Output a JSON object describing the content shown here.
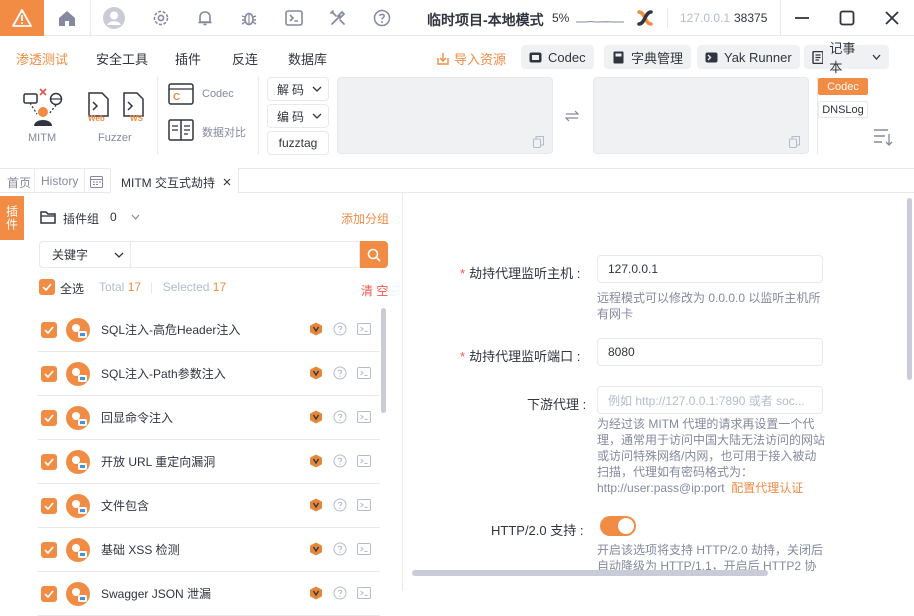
{
  "titlebar": {
    "project_title": "临时项目-本地模式",
    "sysload": "5%",
    "ip": "127.0.0.1",
    "port": "38375"
  },
  "menu": {
    "items": [
      "渗透测试",
      "安全工具",
      "插件",
      "反连",
      "数据库"
    ],
    "import": "导入资源",
    "codec": "Codec",
    "dict": "字典管理",
    "yak_runner": "Yak Runner",
    "notebook": "记事本"
  },
  "toolbar": {
    "mitm": "MITM",
    "fuzzer": "Fuzzer",
    "web": "Web",
    "ws": "WS",
    "codec": "Codec",
    "diff": "数据对比",
    "decode": "解码",
    "encode": "编码",
    "fuzztag": "fuzztag",
    "side_codec": "Codec",
    "side_dnslog": "DNSLog"
  },
  "tabs": {
    "home": "首页",
    "history": "History",
    "mitm": "MITM 交互式劫持"
  },
  "side_tab": "插件",
  "plugins": {
    "group_label": "插件组",
    "group_count": "0",
    "add_group": "添加分组",
    "search_type": "关键字",
    "select_all": "全选",
    "total_label": "Total",
    "total": "17",
    "selected_label": "Selected",
    "selected": "17",
    "clear": "清 空",
    "list": [
      "SQL注入-高危Header注入",
      "SQL注入-Path参数注入",
      "回显命令注入",
      "开放 URL 重定向漏洞",
      "文件包含",
      "基础 XSS 检测",
      "Swagger JSON 泄漏"
    ]
  },
  "form": {
    "host_label": "劫持代理监听主机",
    "host_value": "127.0.0.1",
    "host_help": "远程模式可以修改为 0.0.0.0 以监听主机所有网卡",
    "port_label": "劫持代理监听端口",
    "port_value": "8080",
    "downstream_label": "下游代理",
    "downstream_placeholder": "例如 http://127.0.0.1:7890 或者 soc...",
    "downstream_help": "为经过该 MITM 代理的请求再设置一个代理，通常用于访问中国大陆无法访问的网站或访问特殊网络/内网，也可用于接入被动扫描，代理如有密码格式为：http://user:pass@ip:port",
    "proxy_auth_link": "配置代理认证",
    "http2_label": "HTTP/2.0 支持",
    "http2_enabled": true,
    "http2_help": "开启该选项将支持 HTTP/2.0 劫持，关闭后自动降级为 HTTP/1.1，开启后 HTTP2 协"
  },
  "colors": {
    "accent": "#f28b44",
    "text": "#31343f",
    "muted": "#85899e",
    "border": "#e8e9e8",
    "required": "#f5544d"
  }
}
